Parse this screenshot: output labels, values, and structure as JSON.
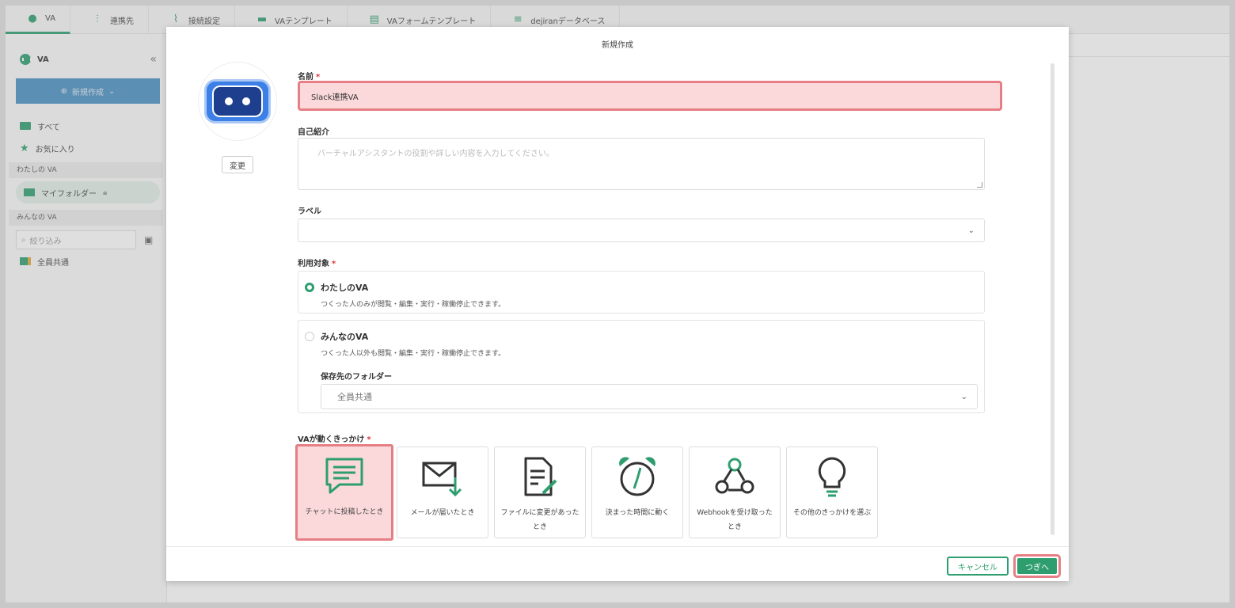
{
  "tabs": [
    {
      "label": "VA",
      "icon": "va-bot-icon",
      "active": true
    },
    {
      "label": "連携先",
      "icon": "connections-icon"
    },
    {
      "label": "接続設定",
      "icon": "connection-settings-icon"
    },
    {
      "label": "VAテンプレート",
      "icon": "va-template-icon"
    },
    {
      "label": "VAフォームテンプレート",
      "icon": "form-template-icon"
    },
    {
      "label": "dejiranデータベース",
      "icon": "database-icon"
    }
  ],
  "sidebar": {
    "title": "VA",
    "collapse": "«",
    "new_button": "新規作成",
    "all": "すべて",
    "favorites": "お気に入り",
    "my_section": "わたしの VA",
    "my_folder": "マイフォルダー",
    "everyone_section": "みんなの VA",
    "search_placeholder": "絞り込み",
    "shared_folder": "全員共通"
  },
  "modal": {
    "title": "新規作成",
    "change_button": "変更",
    "name_label": "名前",
    "name_value": "Slack連携VA",
    "intro_label": "自己紹介",
    "intro_placeholder": "バーチャルアシスタントの役割や詳しい内容を入力してください。",
    "label_label": "ラベル",
    "label_value": "",
    "target_label": "利用対象",
    "option_mine": "わたしのVA",
    "option_mine_desc": "つくった人のみが閲覧・編集・実行・稼働停止できます。",
    "option_everyone": "みんなのVA",
    "option_everyone_desc": "つくった人以外も閲覧・編集・実行・稼働停止できます。",
    "folder_label": "保存先のフォルダー",
    "folder_value": "全員共通",
    "trigger_label": "VAが動くきっかけ",
    "triggers": [
      {
        "text": "チャットに投稿したとき",
        "icon": "chat-icon",
        "selected": true
      },
      {
        "text": "メールが届いたとき",
        "icon": "mail-icon"
      },
      {
        "text": "ファイルに変更があったとき",
        "icon": "file-edit-icon"
      },
      {
        "text": "決まった時間に動く",
        "icon": "alarm-clock-icon"
      },
      {
        "text": "Webhookを受け取ったとき",
        "icon": "webhook-icon"
      },
      {
        "text": "その他のきっかけを選ぶ",
        "icon": "lightbulb-icon"
      }
    ],
    "cancel_button": "キャンセル",
    "next_button": "つぎへ"
  },
  "colors": {
    "accent": "#2e9e6f",
    "highlight": "#e57f85",
    "highlight_fill": "#fbd9da",
    "bot_blue": "#3c7fe6"
  }
}
